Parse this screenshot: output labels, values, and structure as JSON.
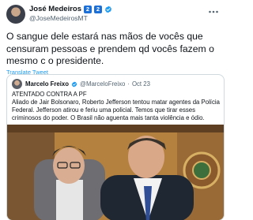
{
  "author": {
    "name": "José Medeiros",
    "badges": [
      "2",
      "2"
    ],
    "handle": "@JoseMedeirosMT"
  },
  "tweet": {
    "text": "O sangue dele estará nas mãos de vocês que censuram pessoas e prendem qd vocês fazem o mesmo c o presidente.",
    "translate_label": "Translate Tweet"
  },
  "quoted": {
    "name": "Marcelo Freixo",
    "handle": "@MarceloFreixo",
    "separator": "·",
    "date": "Oct 23",
    "text": "ATENTADO CONTRA A PF\nAliado de Jair Bolsonaro, Roberto Jefferson tentou matar agentes da Polícia Federal. Jefferson atirou e feriu uma policial. Temos que tirar esses criminosos do poder. O Brasil não aguenta mais tanta violência e ódio."
  },
  "colors": {
    "verified": "#1d9bf0",
    "badge": "#1d6fd8",
    "link": "#1d9bf0",
    "text": "#0f1419",
    "muted": "#536471"
  },
  "icons": {
    "verified": "verified-check-icon",
    "more": "more-options-icon"
  }
}
